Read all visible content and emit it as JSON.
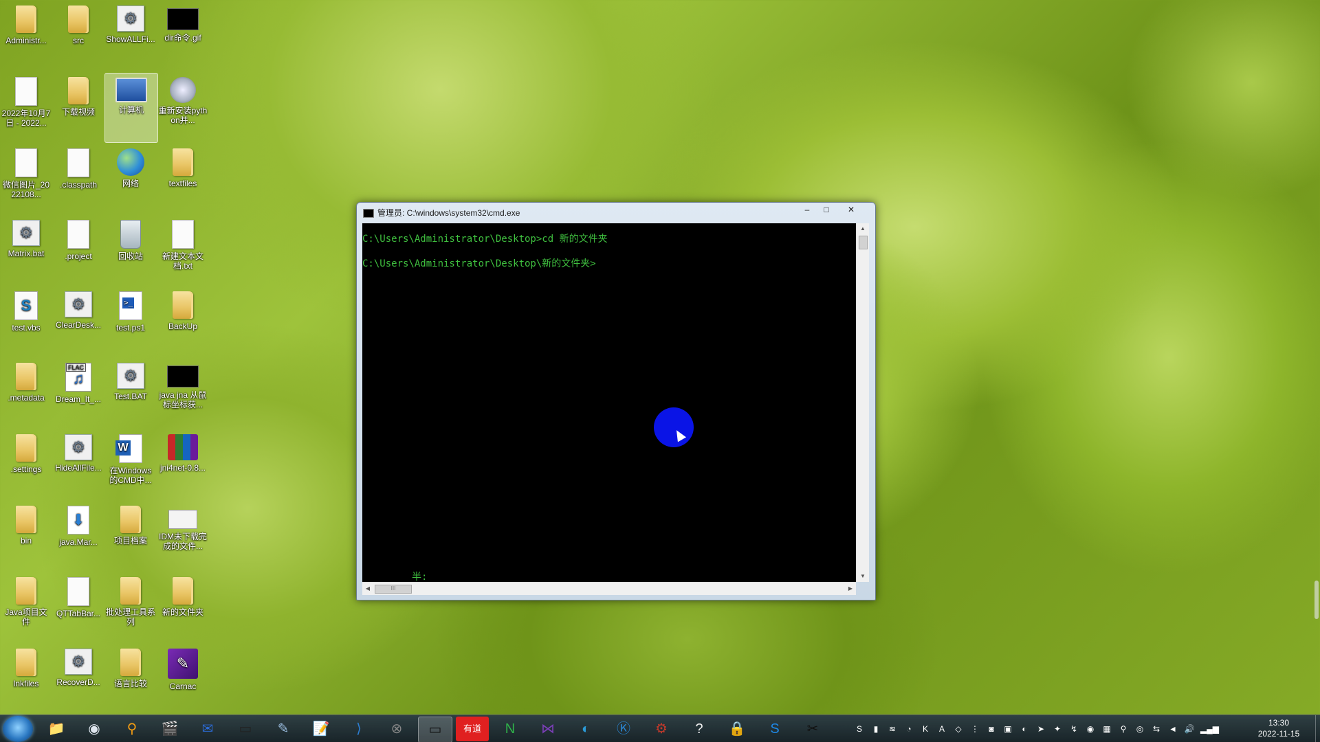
{
  "desktop_icons": [
    {
      "label": "Administr...",
      "icon": "user-folder-icon"
    },
    {
      "label": "src",
      "icon": "folder-icon"
    },
    {
      "label": "ShowALLFi...",
      "icon": "settings-script-icon"
    },
    {
      "label": "dir命令.gif",
      "icon": "image-file-icon"
    },
    {
      "label": "2022年10月7日 - 2022...",
      "icon": "file-icon"
    },
    {
      "label": "下载视频",
      "icon": "folder-icon"
    },
    {
      "label": "计算机",
      "icon": "computer-icon"
    },
    {
      "label": "重新安装python并...",
      "icon": "python-icon"
    },
    {
      "label": "微信图片_2022108...",
      "icon": "file-icon"
    },
    {
      "label": ".classpath",
      "icon": "file-icon"
    },
    {
      "label": "网络",
      "icon": "network-icon"
    },
    {
      "label": "textfiles",
      "icon": "folder-icon"
    },
    {
      "label": "Matrix.bat",
      "icon": "settings-script-icon"
    },
    {
      "label": ".project",
      "icon": "file-icon"
    },
    {
      "label": "回收站",
      "icon": "recycle-bin-icon"
    },
    {
      "label": "新建文本文档.txt",
      "icon": "text-file-icon"
    },
    {
      "label": "test.vbs",
      "icon": "vbs-script-icon"
    },
    {
      "label": "ClearDesk...",
      "icon": "settings-script-icon"
    },
    {
      "label": "test.ps1",
      "icon": "powershell-icon"
    },
    {
      "label": "BackUp",
      "icon": "folder-icon"
    },
    {
      "label": ".metadata",
      "icon": "folder-icon"
    },
    {
      "label": "Dream_It_...",
      "icon": "flac-audio-icon"
    },
    {
      "label": "Test.BAT",
      "icon": "settings-script-icon"
    },
    {
      "label": "java jna 从鼠标坐标获...",
      "icon": "image-file-icon"
    },
    {
      "label": ".settings",
      "icon": "folder-icon"
    },
    {
      "label": "HideAllFile...",
      "icon": "settings-script-icon"
    },
    {
      "label": "在Windows的CMD中...",
      "icon": "word-doc-icon"
    },
    {
      "label": "jni4net-0.8...",
      "icon": "archive-icon"
    },
    {
      "label": "bin",
      "icon": "folder-icon"
    },
    {
      "label": "java.Mar...",
      "icon": "download-file-icon"
    },
    {
      "label": "项目档案",
      "icon": "folder-icon"
    },
    {
      "label": "IDM未下载完成的文件...",
      "icon": "idm-file-icon"
    },
    {
      "label": "Java项目文件",
      "icon": "folder-icon"
    },
    {
      "label": "QTTabBar...",
      "icon": "file-icon"
    },
    {
      "label": "批处理工具系列",
      "icon": "folder-icon"
    },
    {
      "label": "新的文件夹",
      "icon": "folder-icon"
    },
    {
      "label": "lnkfiles",
      "icon": "shortcut-folder-icon"
    },
    {
      "label": "RecoverD...",
      "icon": "settings-script-icon"
    },
    {
      "label": "语言比较",
      "icon": "folder-icon"
    },
    {
      "label": "Carnac",
      "icon": "carnac-icon"
    }
  ],
  "cmd_window": {
    "title": "管理员: C:\\windows\\system32\\cmd.exe",
    "minimize": "‒",
    "maximize": "□",
    "close": "✕",
    "lines": [
      "C:\\Users\\Administrator\\Desktop>cd 新的文件夹",
      "C:\\Users\\Administrator\\Desktop\\新的文件夹>"
    ],
    "ime_indicator": "半:",
    "scroll_thumb_glyph": "III"
  },
  "taskbar": {
    "apps": [
      {
        "name": "explorer",
        "glyph": "📁"
      },
      {
        "name": "browser",
        "glyph": "◉"
      },
      {
        "name": "search",
        "glyph": "⚲"
      },
      {
        "name": "media",
        "glyph": "🎬"
      },
      {
        "name": "mail",
        "glyph": "✉"
      },
      {
        "name": "terminal",
        "glyph": "▭"
      },
      {
        "name": "feather",
        "glyph": "✎"
      },
      {
        "name": "editor",
        "glyph": "📝"
      },
      {
        "name": "vscode",
        "glyph": "⟩"
      },
      {
        "name": "xapp",
        "glyph": "⊗"
      },
      {
        "name": "cmd",
        "glyph": "▭"
      },
      {
        "name": "youdao",
        "glyph": "有道"
      },
      {
        "name": "notepad-n",
        "glyph": "N"
      },
      {
        "name": "visual-studio",
        "glyph": "⋈"
      },
      {
        "name": "edge",
        "glyph": "◐"
      },
      {
        "name": "k-app",
        "glyph": "Ⓚ"
      },
      {
        "name": "tool",
        "glyph": "⚙"
      },
      {
        "name": "help",
        "glyph": "?"
      },
      {
        "name": "lock",
        "glyph": "🔒"
      },
      {
        "name": "s-app",
        "glyph": "S"
      },
      {
        "name": "capcut",
        "glyph": "✂"
      }
    ],
    "clock_time": "13:30",
    "clock_date": "2022-11-15"
  }
}
